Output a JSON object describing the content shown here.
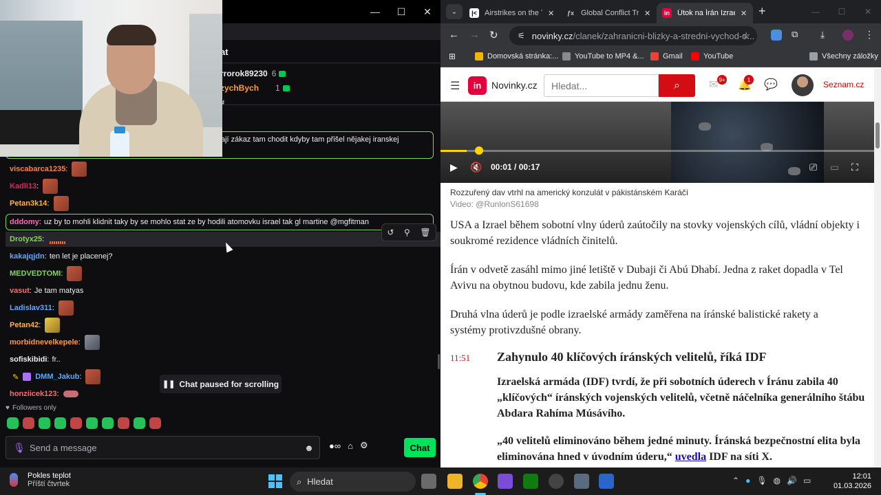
{
  "chat": {
    "header_title": "at",
    "leaderboard": [
      {
        "name": "rrorok89230",
        "count": "6"
      },
      {
        "name": "zychBych",
        "count": "1"
      }
    ],
    "leaderboard_hash": "#",
    "messages": {
      "highlight_top": {
        "text": "ají zákaz tam chodit kdyby tam přišel nějakej iranskej"
      },
      "viscabarca": {
        "user": "viscabarca1235",
        "color": "#ff7f50"
      },
      "kadli": {
        "user": "Kadli13",
        "color": "#e0245e"
      },
      "petan3k": {
        "user": "Petan3k14",
        "color": "#ffb347"
      },
      "dddomy": {
        "user": "dddomy",
        "text": "uz by to mohli klidnit taky by se mohlo stat ze by hodili atomovku israel tak gl martine @mgfitman",
        "color": "#ff69b4"
      },
      "drotyx": {
        "user": "Drotyx25",
        "color": "#7fd858"
      },
      "kakajqjdn": {
        "user": "kakajqjdn",
        "text": "ten let je placenej?",
        "color": "#5da9ff"
      },
      "medved": {
        "user": "MEDVEDTOMI",
        "color": "#7fd858"
      },
      "vasut": {
        "user": "vasut",
        "text": "Je tam matyas",
        "color": "#ff6b6b"
      },
      "ladislav": {
        "user": "Ladislav311",
        "color": "#5da9ff"
      },
      "petan42": {
        "user": "Petan42",
        "color": "#ffb347"
      },
      "morbid": {
        "user": "morbidnevelkepele",
        "color": "#ff9a3c"
      },
      "sofiski": {
        "user": "sofiskibidi",
        "text": "fr..",
        "color": "#efeff1"
      },
      "dmm": {
        "user": "DMM_Jakub",
        "color": "#5da9ff"
      },
      "honziicek": {
        "user": "honziicek123",
        "color": "#ff6b6b"
      }
    },
    "paused_label": "Chat paused for scrolling",
    "followers_only": "Followers only",
    "input_placeholder": "Send a message",
    "chat_button": "Chat"
  },
  "browser": {
    "tabs": [
      {
        "title": "Airstrikes on the Ta",
        "favicon_color": "#ffffff",
        "favicon_text": "|<"
      },
      {
        "title": "Global Conflict Tra",
        "favicon_color": "#35363a",
        "favicon_text": "ƒx"
      },
      {
        "title": "Útok na Írán Izrael",
        "favicon_color": "#e3003d",
        "favicon_text": "in"
      }
    ],
    "url_host": "novinky.cz",
    "url_path": "/clanek/zahranicni-blizky-a-stredni-vychod-o...",
    "bookmarks": [
      {
        "label": "Domovská stránka:...",
        "color": "#f4b400"
      },
      {
        "label": "YouTube to MP4 &...",
        "color": "#8a8a8a"
      },
      {
        "label": "Gmail",
        "color": "#ea4335"
      },
      {
        "label": "YouTube",
        "color": "#ff0000"
      },
      {
        "label": "Všechny záložky",
        "color": "#9aa0a6"
      }
    ]
  },
  "site": {
    "logo_text": "in",
    "name": "Novinky.cz",
    "search_placeholder": "Hledat...",
    "mail_badge": "9+",
    "bell_badge": "1",
    "seznam": "Seznam.cz",
    "video": {
      "time_current": "00:01",
      "time_total": "00:17",
      "progress": 0.06
    },
    "caption": "Rozzuřený dav vtrhl na americký konzulát v pákistánském Karáčí",
    "credit": "Video: @RunlonS61698",
    "paragraphs": [
      "USA a Izrael během sobotní vlny úderů zaútočily na stovky vojenských cílů, vládní objekty i soukromé rezidence vládních činitelů.",
      "Írán v odvetě zasáhl mimo jiné letiště v Dubaji či Abú Dhabí. Jedna z raket dopadla v Tel Avivu na obytnou budovu, kde zabila jednu ženu.",
      "Druhá vlna úderů je podle izraelské armády zaměřena na íránské balistické rakety a systémy protivzdušné obrany."
    ],
    "update": {
      "time": "11:51",
      "headline": "Zahynulo 40 klíčových íránských velitelů, říká IDF",
      "lead": "Izraelská armáda (IDF) tvrdí, že při sobotních úderech v Íránu zabila 40 „klíčových“ íránských vojenských velitelů, včetně náčelníka generálního štábu Abdara Rahíma Músávího.",
      "quote_start": "„40 velitelů eliminováno během jedné minuty. Íránská bezpečnostní elita byla eliminována hned v úvodním úderu,“ ",
      "quote_link": "uvedla",
      "quote_end": " IDF na síti X."
    }
  },
  "taskbar": {
    "weather_title": "Pokles teplot",
    "weather_sub": "Příští čtvrtek",
    "search_label": "Hledat",
    "time": "12:01",
    "date": "01.03.2026"
  }
}
